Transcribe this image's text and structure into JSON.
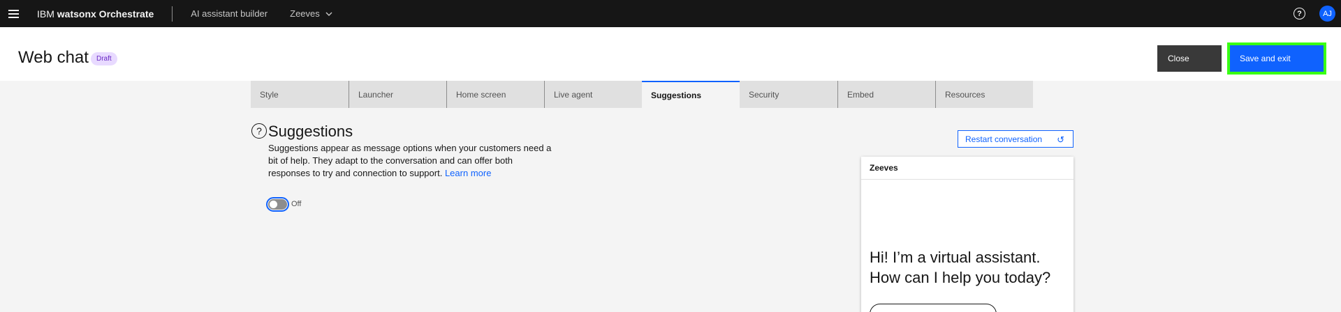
{
  "topbar": {
    "brand_prefix": "IBM",
    "brand_name": "watsonx Orchestrate",
    "crumb": "AI assistant builder",
    "assistant": "Zeeves",
    "avatar_initials": "AJ"
  },
  "header": {
    "title": "Web chat",
    "badge": "Draft",
    "close_label": "Close",
    "save_label": "Save and exit"
  },
  "tabs": [
    {
      "label": "Style"
    },
    {
      "label": "Launcher"
    },
    {
      "label": "Home screen"
    },
    {
      "label": "Live agent"
    },
    {
      "label": "Suggestions"
    },
    {
      "label": "Security"
    },
    {
      "label": "Embed"
    },
    {
      "label": "Resources"
    }
  ],
  "suggestions": {
    "title": "Suggestions",
    "description": "Suggestions appear as message options when your customers need a bit of help. They adapt to the conversation and can offer both responses to try and connection to support.",
    "learn_more": "Learn more",
    "toggle_state": "Off"
  },
  "preview": {
    "restart_label": "Restart conversation",
    "assistant_name": "Zeeves",
    "greeting": "Hi! I’m a virtual assistant. How can I help you today?"
  },
  "colors": {
    "accent": "#0f62fe",
    "topbar_bg": "#161616",
    "highlight": "#39ff14",
    "badge_bg": "#e8daff"
  },
  "icons": [
    "hamburger-icon",
    "chevron-down-icon",
    "help-icon",
    "question-icon",
    "restart-icon"
  ]
}
